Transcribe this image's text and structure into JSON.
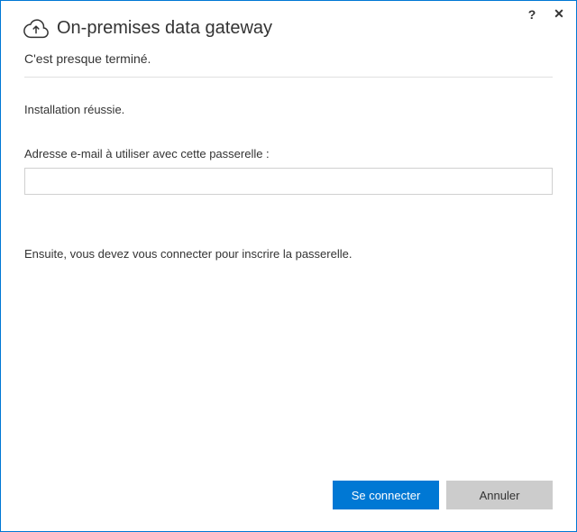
{
  "titlebar": {
    "help_symbol": "?",
    "close_symbol": "✕"
  },
  "header": {
    "title": "On-premises data gateway"
  },
  "subheader": "C'est presque terminé.",
  "status": "Installation réussie.",
  "email": {
    "label": "Adresse e-mail à utiliser avec cette passerelle :",
    "value": ""
  },
  "instruction": "Ensuite, vous devez vous connecter pour inscrire la passerelle.",
  "footer": {
    "connect_label": "Se connecter",
    "cancel_label": "Annuler"
  }
}
